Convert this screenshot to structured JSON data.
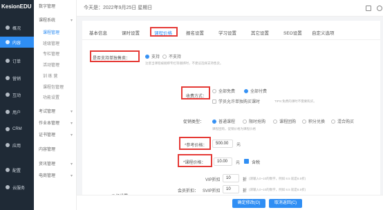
{
  "brand": "KesionEDU",
  "header": {
    "date": "今天是：2022年9月25日 星期日"
  },
  "nav_main": [
    {
      "label": "概况"
    },
    {
      "label": "内容"
    },
    {
      "label": "订单"
    },
    {
      "label": "营销"
    },
    {
      "label": "互动"
    },
    {
      "label": "用户"
    },
    {
      "label": "CRM"
    },
    {
      "label": "应用"
    },
    {
      "label": "配置"
    },
    {
      "label": "云服务"
    }
  ],
  "nav_sub": {
    "sec1": "数字管理",
    "sec2": "课程系统",
    "items": [
      "课程管理",
      "班级管理",
      "专栏管理",
      "活动管理",
      "训 练 营",
      "课程包管理",
      "功能设置"
    ],
    "sec3": "考试管理",
    "sec4": "作业本管理",
    "sec5": "证书管理",
    "sec6": "内容管理",
    "sec7": "资讯管理",
    "sec8": "电商管理"
  },
  "tabs": [
    "基本信息",
    "课时设置",
    "课程价格",
    "报名设置",
    "学习设置",
    "其它设置",
    "SEO设置",
    "自定义选项"
  ],
  "form": {
    "single_label": "是否支持单独售卖：",
    "support": "支持",
    "not_support": "不支持",
    "single_hint": "注意当课程被捆绑专栏等捆绑时，不建议选择支持售卖。",
    "charge_label": "收费方式：",
    "all_free": "全部免费",
    "all_paid": "全部付费",
    "partial_free": "学员允许单独购买课时",
    "partial_hint": "TIPS:免费的课时不需要购买。",
    "promo_label": "促销类型：",
    "promo_options": [
      "普通课程",
      "限时抢购",
      "课程团购",
      "积分兑换",
      "混合购买"
    ],
    "promo_hint": "课程团购，促销价格为课程价格",
    "ref_price_label": "*参考价格：",
    "ref_price": "500.00",
    "price_unit": "元",
    "course_price_label": "*课程价格：",
    "course_price": "10.00",
    "tax_label": "含税",
    "member_label": "会员折扣：",
    "vip_label": "VIP折扣",
    "svip_label": "SVIP折扣",
    "discount_value": "10",
    "discount_unit": "折",
    "discount_hint": "(请输入0~10的数字，例如 8.5 就是8.5折)",
    "tail_label": "价格设置："
  },
  "buttons": {
    "confirm": "确定修改(O)",
    "cancel": "取消返回(C)"
  }
}
